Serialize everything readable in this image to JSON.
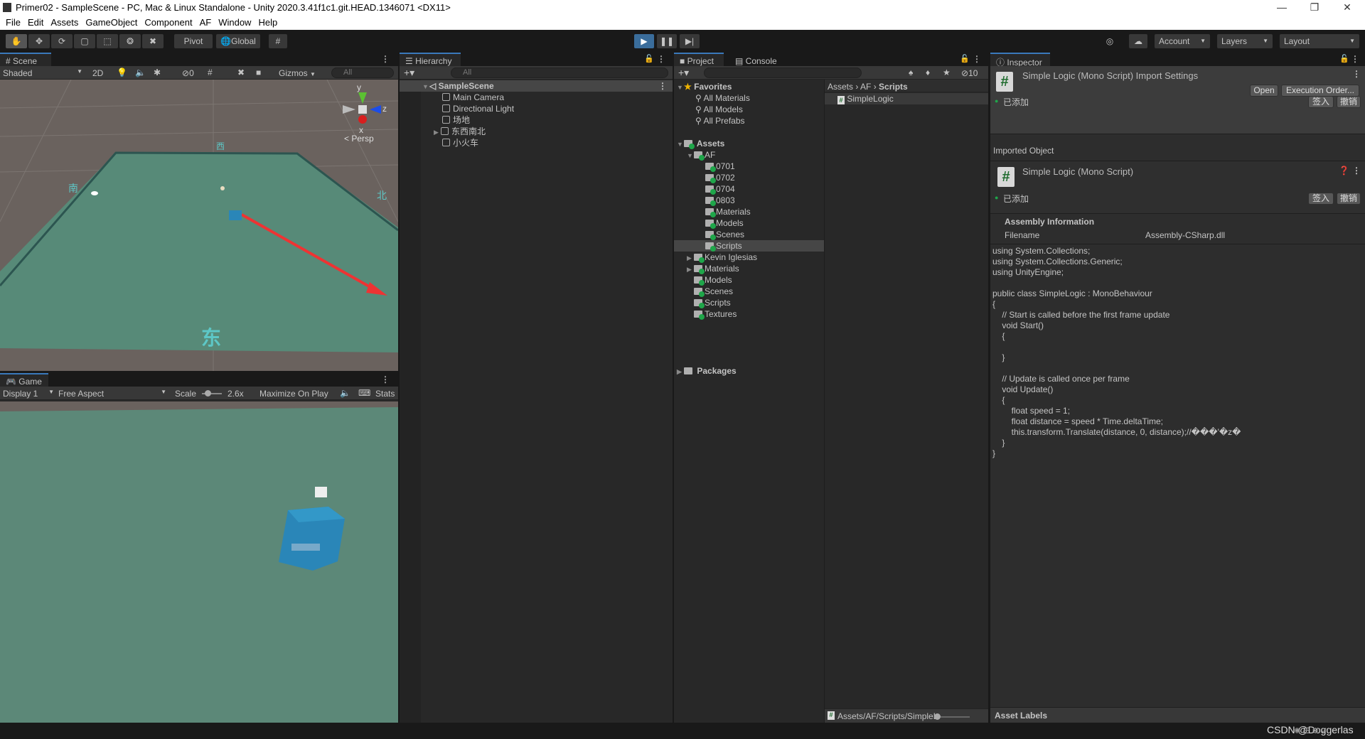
{
  "window": {
    "title": "Primer02 - SampleScene - PC, Mac & Linux Standalone - Unity 2020.3.41f1c1.git.HEAD.1346071 <DX11>"
  },
  "menu": [
    "File",
    "Edit",
    "Assets",
    "GameObject",
    "Component",
    "AF",
    "Window",
    "Help"
  ],
  "toolbar": {
    "pivot": "Pivot",
    "global": "Global",
    "account": "Account",
    "layers": "Layers",
    "layout": "Layout"
  },
  "scene": {
    "tab": "Scene",
    "shading": "Shaded",
    "mode_2d": "2D",
    "hidden_count": "0",
    "gizmos": "Gizmos",
    "search_placeholder": "All",
    "persp": "Persp",
    "axis_y": "y",
    "axis_z": "z",
    "axis_x": "x"
  },
  "game": {
    "tab": "Game",
    "display": "Display 1",
    "aspect": "Free Aspect",
    "scale_label": "Scale",
    "scale_value": "2.6x",
    "scale_fraction": 0.3,
    "maximize": "Maximize On Play",
    "stats": "Stats"
  },
  "hierarchy": {
    "tab": "Hierarchy",
    "search_placeholder": "All",
    "scene": "SampleScene",
    "items": [
      {
        "label": "Main Camera"
      },
      {
        "label": "Directional Light"
      },
      {
        "label": "场地"
      },
      {
        "label": "东西南北",
        "expandable": true
      },
      {
        "label": "小火车"
      }
    ]
  },
  "project": {
    "tab": "Project",
    "console_tab": "Console",
    "hidden_count": "10",
    "favorites": {
      "label": "Favorites",
      "items": [
        "All Materials",
        "All Models",
        "All Prefabs"
      ]
    },
    "assets_label": "Assets",
    "af_label": "AF",
    "af_children": [
      "0701",
      "0702",
      "0704",
      "0803",
      "Materials",
      "Models",
      "Scenes",
      "Scripts"
    ],
    "selected_folder": "Scripts",
    "asset_children": [
      {
        "label": "Kevin Iglesias",
        "expandable": true
      },
      {
        "label": "Materials",
        "expandable": true
      },
      {
        "label": "Models"
      },
      {
        "label": "Scenes"
      },
      {
        "label": "Scripts"
      },
      {
        "label": "Textures"
      }
    ],
    "packages_label": "Packages",
    "breadcrumb": [
      "Assets",
      "AF",
      "Scripts"
    ],
    "files": [
      "SimpleLogic"
    ],
    "status_path": "Assets/AF/Scripts/SimpleLogic.cs"
  },
  "inspector": {
    "tab": "Inspector",
    "header_title": "Simple Logic (Mono Script) Import Settings",
    "open": "Open",
    "execution_order": "Execution Order...",
    "vcs_status": "已添加",
    "checkin": "签入",
    "revert": "撤销",
    "imported_object": "Imported Object",
    "object_title": "Simple Logic (Mono Script)",
    "assembly_info": "Assembly Information",
    "filename_label": "Filename",
    "filename_value": "Assembly-CSharp.dll",
    "code": "using System.Collections;\nusing System.Collections.Generic;\nusing UnityEngine;\n\npublic class SimpleLogic : MonoBehaviour\n{\n    // Start is called before the first frame update\n    void Start()\n    {\n\n    }\n\n    // Update is called once per frame\n    void Update()\n    {\n        float speed = 1;\n        float distance = speed * Time.deltaTime;\n        this.transform.Translate(distance, 0, distance);//���'�z�\n    }\n}",
    "asset_labels": "Asset Labels"
  },
  "watermark": "CSDN @Doggerlas",
  "colors": {
    "accent": "#3a79bb",
    "panel": "#282828",
    "ground": "#578a78",
    "car": "#2a86b8",
    "arrow": "#ee3333"
  }
}
